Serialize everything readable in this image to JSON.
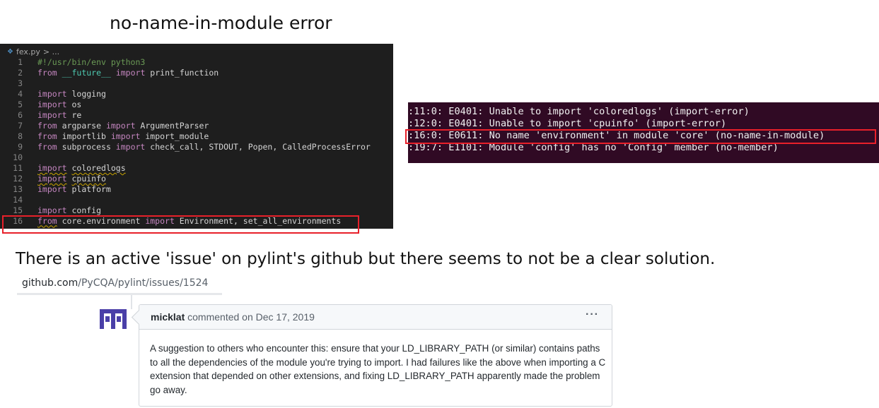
{
  "heading": "no-name-in-module error",
  "editor": {
    "breadcrumb_file": "fex.py",
    "breadcrumb_rest": "> ...",
    "lines": [
      {
        "n": "1",
        "parts": [
          {
            "t": "#!/usr/bin/env python3",
            "c": "cm"
          }
        ]
      },
      {
        "n": "2",
        "parts": [
          {
            "t": "from",
            "c": "kw"
          },
          {
            "t": " "
          },
          {
            "t": "__future__",
            "c": "dn"
          },
          {
            "t": " "
          },
          {
            "t": "import",
            "c": "kw"
          },
          {
            "t": " print_function"
          }
        ]
      },
      {
        "n": "3",
        "parts": []
      },
      {
        "n": "4",
        "parts": [
          {
            "t": "import",
            "c": "kw"
          },
          {
            "t": " logging"
          }
        ]
      },
      {
        "n": "5",
        "parts": [
          {
            "t": "import",
            "c": "kw"
          },
          {
            "t": " os"
          }
        ]
      },
      {
        "n": "6",
        "parts": [
          {
            "t": "import",
            "c": "kw"
          },
          {
            "t": " re"
          }
        ]
      },
      {
        "n": "7",
        "parts": [
          {
            "t": "from",
            "c": "kw"
          },
          {
            "t": " argparse "
          },
          {
            "t": "import",
            "c": "kw"
          },
          {
            "t": " ArgumentParser"
          }
        ]
      },
      {
        "n": "8",
        "parts": [
          {
            "t": "from",
            "c": "kw"
          },
          {
            "t": " importlib "
          },
          {
            "t": "import",
            "c": "kw"
          },
          {
            "t": " import_module"
          }
        ]
      },
      {
        "n": "9",
        "parts": [
          {
            "t": "from",
            "c": "kw"
          },
          {
            "t": " subprocess "
          },
          {
            "t": "import",
            "c": "kw"
          },
          {
            "t": " check_call, STDOUT, Popen, CalledProcessError"
          }
        ]
      },
      {
        "n": "10",
        "parts": []
      },
      {
        "n": "11",
        "parts": [
          {
            "t": "import",
            "c": "kw wavy"
          },
          {
            "t": " "
          },
          {
            "t": "coloredlogs",
            "c": "wavy"
          }
        ]
      },
      {
        "n": "12",
        "parts": [
          {
            "t": "import",
            "c": "kw wavy"
          },
          {
            "t": " "
          },
          {
            "t": "cpuinfo",
            "c": "wavy"
          }
        ]
      },
      {
        "n": "13",
        "parts": [
          {
            "t": "import",
            "c": "kw"
          },
          {
            "t": " platform"
          }
        ]
      },
      {
        "n": "14",
        "parts": []
      },
      {
        "n": "15",
        "parts": [
          {
            "t": "import",
            "c": "kw"
          },
          {
            "t": " config"
          }
        ]
      },
      {
        "n": "16",
        "parts": [
          {
            "t": "from",
            "c": "kw wavy"
          },
          {
            "t": " core.environment "
          },
          {
            "t": "import",
            "c": "kw"
          },
          {
            "t": " Environment, set_all_environments"
          }
        ]
      }
    ]
  },
  "terminal": {
    "lines": [
      ":11:0: E0401: Unable to import 'coloredlogs' (import-error)",
      ":12:0: E0401: Unable to import 'cpuinfo' (import-error)",
      ":16:0: E0611: No name 'environment' in module 'core' (no-name-in-module)",
      ":19:7: E1101: Module 'config' has no 'Config' member (no-member)"
    ]
  },
  "issue_text": "There is an active 'issue' on pylint's github but there seems to not be a clear solution.",
  "url": {
    "host": "github.com",
    "path": "/PyCQA/pylint/issues/1524"
  },
  "comment": {
    "author": "micklat",
    "action": "commented on Dec 17, 2019",
    "menu": "···",
    "body": "A suggestion to others who encounter this: ensure that your LD_LIBRARY_PATH (or similar) contains paths to all the dependencies of the module you're trying to import. I had failures like the above when importing a C extension that depended on other extensions, and fixing LD_LIBRARY_PATH apparently made the problem go away."
  },
  "colors": {
    "editor_bg": "#1e1e1e",
    "terminal_bg": "#300a24",
    "highlight_box": "#e8202a",
    "avatar": "#4a3fa8"
  },
  "icons": [
    "python-file-icon",
    "user-avatar-icon",
    "kebab-menu-icon"
  ]
}
